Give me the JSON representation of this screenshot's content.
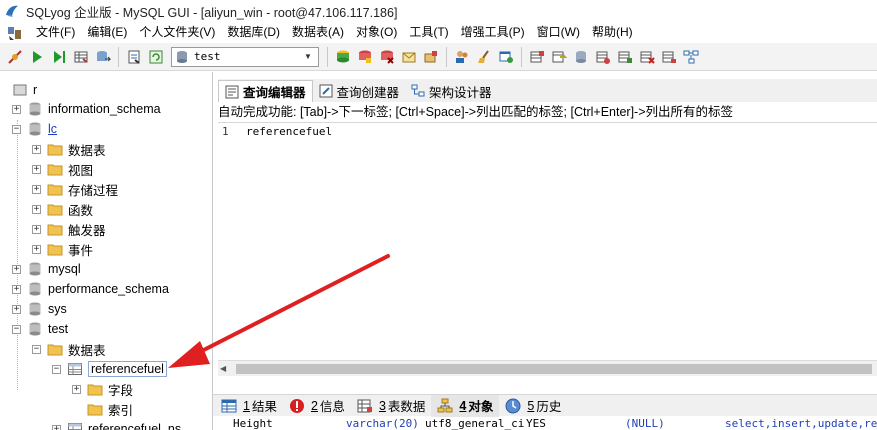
{
  "window": {
    "title": "SQLyog 企业版 - MySQL GUI - [aliyun_win - root@47.106.117.186]"
  },
  "menu": [
    "文件(F)",
    "编辑(E)",
    "个人文件夹(V)",
    "数据库(D)",
    "数据表(A)",
    "对象(O)",
    "工具(T)",
    "增强工具(P)",
    "窗口(W)",
    "帮助(H)"
  ],
  "toolbar": {
    "db_select_value": "test"
  },
  "tree": {
    "root_fragment": "r",
    "items": {
      "information_schema": "information_schema",
      "lc": "lc",
      "lc_tables": "数据表",
      "lc_views": "视图",
      "lc_procs": "存储过程",
      "lc_funcs": "函数",
      "lc_triggers": "触发器",
      "lc_events": "事件",
      "mysql": "mysql",
      "performance_schema": "performance_schema",
      "sys": "sys",
      "test": "test",
      "test_tables": "数据表",
      "referencefuel": "referencefuel",
      "fields": "字段",
      "indexes": "索引",
      "referencefuel_ns": "referencefuel_ns"
    }
  },
  "editor_tabs": [
    "查询编辑器",
    "查询创建器",
    "架构设计器"
  ],
  "hint": "自动完成功能: [Tab]->下一标签; [Ctrl+Space]->列出匹配的标签; [Ctrl+Enter]->列出所有的标签",
  "editor": {
    "line_number": "1",
    "code": "referencefuel"
  },
  "result_tabs": [
    {
      "num": "1",
      "label": "结果"
    },
    {
      "num": "2",
      "label": "信息"
    },
    {
      "num": "3",
      "label": "表数据"
    },
    {
      "num": "4",
      "label": "对象"
    },
    {
      "num": "5",
      "label": "历史"
    }
  ],
  "result_row": {
    "name": "Height",
    "type": "varchar(20)",
    "collation": "utf8_general_ci",
    "nullable": "YES",
    "default": "(NULL)",
    "privileges": "select,insert,update,references"
  },
  "colors": {
    "arrow": "#e02020",
    "folder": "#f2c24e",
    "link": "#1a3ec8"
  }
}
